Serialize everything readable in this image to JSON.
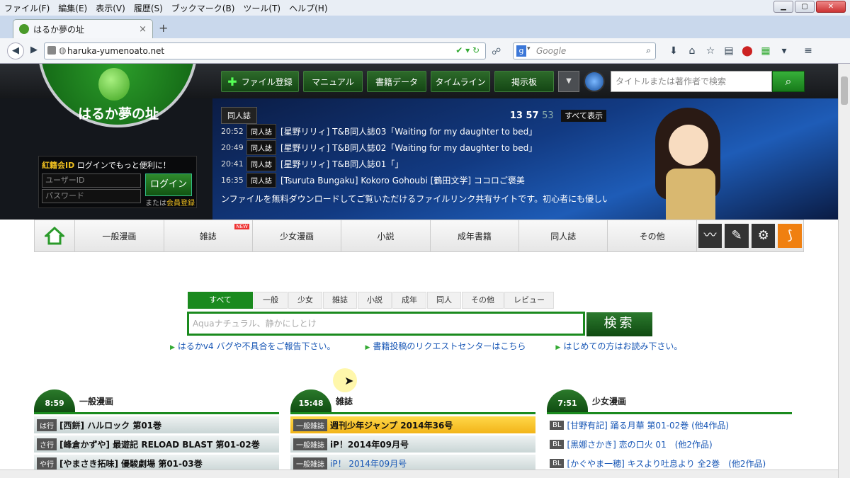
{
  "browser": {
    "menu": [
      "ファイル(F)",
      "編集(E)",
      "表示(V)",
      "履歴(S)",
      "ブックマーク(B)",
      "ツール(T)",
      "ヘルプ(H)"
    ],
    "tab_title": "はるか夢の址",
    "tab_close": "×",
    "new_tab": "+",
    "url": "haruka-yumenoato.net",
    "search_engine_placeholder": "Google"
  },
  "site": {
    "logo_text": "はるか夢の址",
    "topnav": [
      "ファイル登録",
      "マニュアル",
      "書籍データ",
      "タイムライン",
      "掲示板"
    ],
    "topnav_add_glyph": "✚",
    "search_placeholder": "タイトルまたは著作者で検索",
    "feed_tag": "同人誌",
    "counts": {
      "a": "13",
      "b": "57",
      "c": "53",
      "show_all": "すべて表示"
    },
    "feed": [
      {
        "time": "20:52",
        "cat": "同人誌",
        "title": "[星野リリィ] T&B同人誌03「Waiting for my daughter to bed」"
      },
      {
        "time": "20:49",
        "cat": "同人誌",
        "title": "[星野リリィ] T&B同人誌02「Waiting for my daughter to bed」"
      },
      {
        "time": "20:41",
        "cat": "同人誌",
        "title": "[星野リリィ] T&B同人誌01「」"
      },
      {
        "time": "16:35",
        "cat": "同人誌",
        "title": "[Tsuruta Bungaku] Kokoro Gohoubi [鶴田文学] ココロご褒美"
      }
    ],
    "tagline": "ンファイルを無料ダウンロードしてご覧いただけるファイルリンク共有サイトです。初心者にも優しいマニ",
    "login": {
      "id_label": "紅籍会ID",
      "lead": " ログインでもっと便利に！",
      "user_placeholder": "ユーザーID",
      "pass_placeholder": "パスワード",
      "button": "ログイン",
      "register_prefix": "または",
      "register_link": "会員登録"
    },
    "categories": [
      "一般漫画",
      "雑誌",
      "少女漫画",
      "小説",
      "成年書籍",
      "同人誌",
      "その他"
    ],
    "new_badge": "NEW",
    "search_tabs": [
      "すべて",
      "一般",
      "少女",
      "雑誌",
      "小説",
      "成年",
      "同人",
      "その他",
      "レビュー"
    ],
    "main_search_placeholder": "Aquaナチュラル、静かにしとけ",
    "main_search_button": "検索",
    "links": [
      "はるかv4 バグや不具合をご報告下さい。",
      "書籍投稿のリクエストセンターはこちら",
      "はじめての方はお読み下さい。"
    ],
    "columns": [
      {
        "time": "8:59",
        "title": "一般漫画",
        "items": [
          {
            "badge": "は行",
            "text": "[西餅] ハルロック 第01巻"
          },
          {
            "badge": "さ行",
            "text": "[峰倉かずや] 最遊記 RELOAD BLAST 第01-02巻"
          },
          {
            "badge": "や行",
            "text": "[やまさき拓味] 優駿劇場 第01-03巻"
          }
        ]
      },
      {
        "time": "15:48",
        "title": "雑誌",
        "items": [
          {
            "badge": "一般雑誌",
            "text": "週刊少年ジャンプ 2014年36号"
          },
          {
            "badge": "一般雑誌",
            "text": "iP！2014年09月号"
          },
          {
            "badge": "一般雑誌",
            "text": "iP！ 2014年09月号"
          }
        ]
      },
      {
        "time": "7:51",
        "title": "少女漫画",
        "items": [
          {
            "badge": "BL",
            "text": "[甘野有記] 踊る月華 第01-02巻 (他4作品)"
          },
          {
            "badge": "BL",
            "text": "[黒娜さかき] 恋の口火 01　(他2作品)"
          },
          {
            "badge": "BL",
            "text": "[かぐやま一穂] キスより吐息より 全2巻　(他2作品)"
          }
        ]
      }
    ]
  },
  "colors": {
    "accent": "#1a8a1e",
    "link": "#1756b5",
    "highlight": "#f2b418"
  }
}
